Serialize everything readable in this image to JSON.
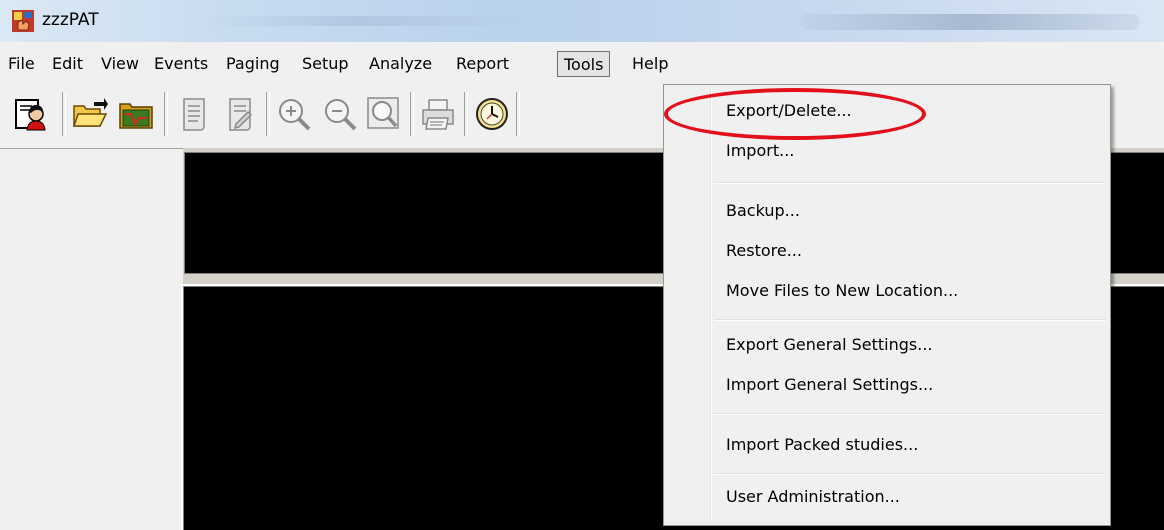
{
  "window": {
    "title": "zzzPAT",
    "app_icon": "zzzpat-app-icon"
  },
  "menubar": {
    "items": [
      {
        "label": "File"
      },
      {
        "label": "Edit"
      },
      {
        "label": "View"
      },
      {
        "label": "Events"
      },
      {
        "label": "Paging"
      },
      {
        "label": "Setup"
      },
      {
        "label": "Analyze"
      },
      {
        "label": "Report"
      },
      {
        "label": "Tools"
      },
      {
        "label": "Help"
      }
    ],
    "active": "Tools"
  },
  "toolbar": {
    "buttons": [
      {
        "icon": "patient-icon"
      },
      {
        "icon": "open-folder-icon"
      },
      {
        "icon": "study-folder-icon"
      },
      {
        "icon": "report-icon"
      },
      {
        "icon": "report-edit-icon"
      },
      {
        "icon": "zoom-in-icon"
      },
      {
        "icon": "zoom-out-icon"
      },
      {
        "icon": "zoom-fit-icon"
      },
      {
        "icon": "print-icon"
      },
      {
        "icon": "clock-icon"
      }
    ]
  },
  "tools_menu": {
    "items": [
      {
        "label": "Export/Delete..."
      },
      {
        "label": "Import..."
      },
      {
        "label": "Backup..."
      },
      {
        "label": "Restore..."
      },
      {
        "label": "Move Files to New Location..."
      },
      {
        "label": "Export General Settings..."
      },
      {
        "label": "Import General Settings..."
      },
      {
        "label": "Import Packed studies..."
      },
      {
        "label": "User Administration..."
      }
    ],
    "highlighted_item": "Export/Delete...",
    "highlight_color": "#e3101b"
  }
}
